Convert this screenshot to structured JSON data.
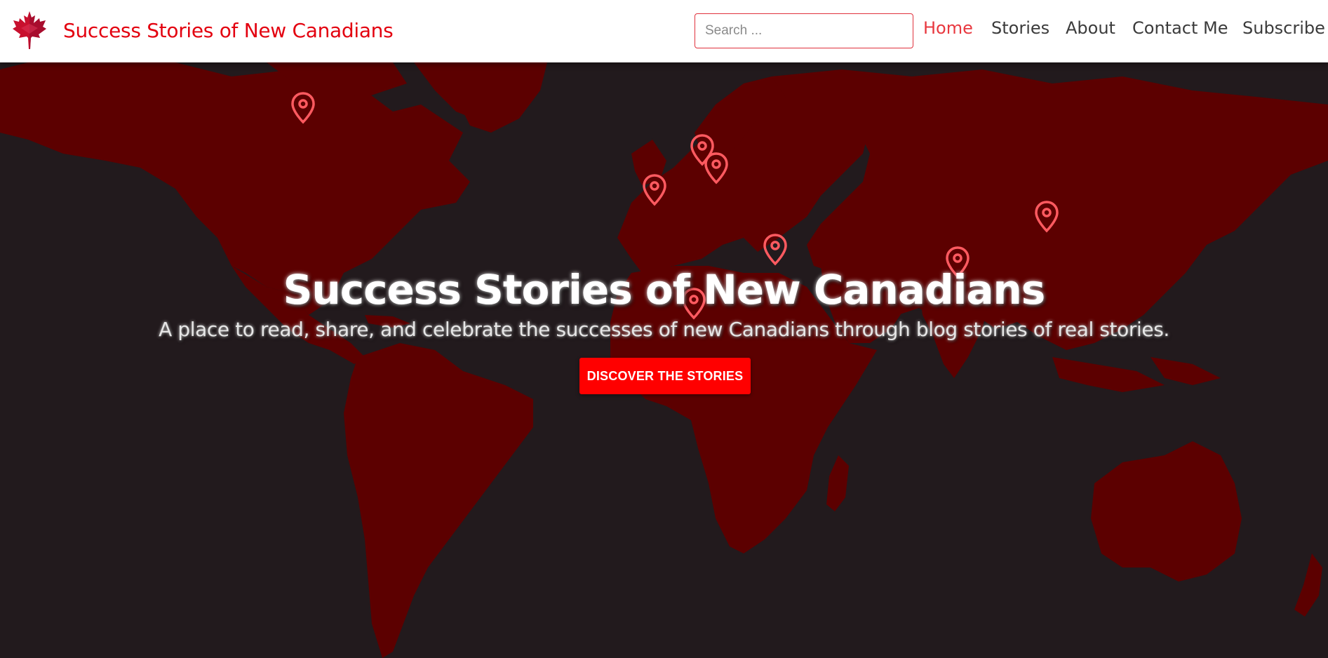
{
  "header": {
    "logo_icon": "maple-leaf-icon",
    "brand_title": "Success Stories of New Canadians",
    "search_placeholder": "Search ...",
    "nav": [
      {
        "label": "Home",
        "active": true
      },
      {
        "label": "Stories",
        "active": false
      },
      {
        "label": "About",
        "active": false
      },
      {
        "label": "Contact Me",
        "active": false
      },
      {
        "label": "Subscribe",
        "active": false
      }
    ]
  },
  "hero": {
    "background": "world-map",
    "pin_icon": "map-pin-icon",
    "title": "Success Stories of New Canadians",
    "subtitle": "A place to read, share, and celebrate the successes of new Canadians through blog stories of real stories.",
    "cta_label": "DISCOVER THE STORIES"
  },
  "colors": {
    "brand_red": "#e3000f",
    "nav_active": "#e8383f",
    "nav_text": "#3b3b3b",
    "map_land": "#5c0000",
    "map_ocean": "#221a1d",
    "pin": "#ff5a60",
    "cta_bg": "#ff0000"
  }
}
